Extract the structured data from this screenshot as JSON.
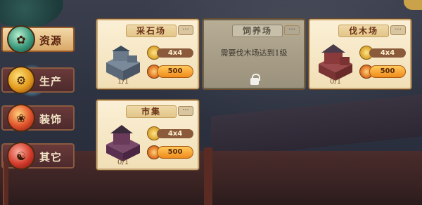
{
  "categories": [
    {
      "label": "资源",
      "active": true
    },
    {
      "label": "生产",
      "active": false
    },
    {
      "label": "装饰",
      "active": false
    },
    {
      "label": "其它",
      "active": false
    }
  ],
  "cards": [
    {
      "title": "采石场",
      "more": "···",
      "size": "4x4",
      "cost": "500",
      "count": "1/1",
      "locked": false
    },
    {
      "title": "饲养场",
      "more": "···",
      "lock_text": "需要伐木场达到1级",
      "locked": true
    },
    {
      "title": "伐木场",
      "more": "···",
      "size": "4x4",
      "cost": "500",
      "count": "0/1",
      "locked": false
    },
    {
      "title": "市集",
      "more": "···",
      "size": "4x4",
      "cost": "500",
      "count": "0/1",
      "locked": false
    }
  ],
  "colors": {
    "card_bg": "#fbf0d6",
    "title_text": "#6a3318",
    "cost_button": "#f08a1c",
    "locked_bg": "#b8ad95"
  }
}
